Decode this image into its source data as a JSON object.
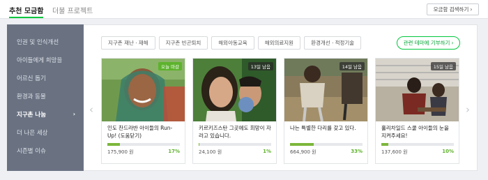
{
  "tabs": {
    "active": "추천 모금함",
    "other": "더불 프로젝트"
  },
  "search_button": {
    "label": "모금함 검색하기",
    "icon": "chevron-right-icon"
  },
  "sidebar": {
    "items": [
      {
        "label": "인권 및 인식개선",
        "active": false
      },
      {
        "label": "아이들에게 희망을",
        "active": false
      },
      {
        "label": "어르신 돕기",
        "active": false
      },
      {
        "label": "환경과 동물",
        "active": false
      },
      {
        "label": "지구촌 나눔",
        "active": true
      },
      {
        "label": "더 나은 세상",
        "active": false
      },
      {
        "label": "시즌별 이슈",
        "active": false
      }
    ],
    "active_arrow": "›"
  },
  "chips": [
    "지구촌 재난ㆍ재해",
    "지구촌 빈곤퇴치",
    "해외아동교육",
    "해외의료지원",
    "환경개선ㆍ적정기술"
  ],
  "donate_button": {
    "label": "관련 테마에 기부하기",
    "arrow": "›"
  },
  "carousel": {
    "prev": "‹",
    "next": "›"
  },
  "cards": [
    {
      "badge": "오늘 마감",
      "badge_type": "today",
      "title": "인도 찬드라반 아이들의 Run-Up! (도움닫기)",
      "amount": "175,900 원",
      "percent": "17%",
      "progress": 0.17
    },
    {
      "badge": "13일 남음",
      "badge_type": "days",
      "title": "키르키즈스탄 그곳에도 희망이 자라고 있습니다.",
      "amount": "24,100 원",
      "percent": "1%",
      "progress": 0.01
    },
    {
      "badge": "14일 남음",
      "badge_type": "days",
      "title": "나는 특별한 다리를 갖고 있다.",
      "amount": "664,900 원",
      "percent": "33%",
      "progress": 0.33
    },
    {
      "badge": "15일 남음",
      "badge_type": "days",
      "title": "홀리차일드 스쿨 아이들의 눈을 지켜주세요!",
      "amount": "137,600 원",
      "percent": "10%",
      "progress": 0.1
    }
  ],
  "colors": {
    "accent": "#00c73c",
    "progress": "#7cb73b",
    "sidebar_bg": "#6a7282"
  }
}
